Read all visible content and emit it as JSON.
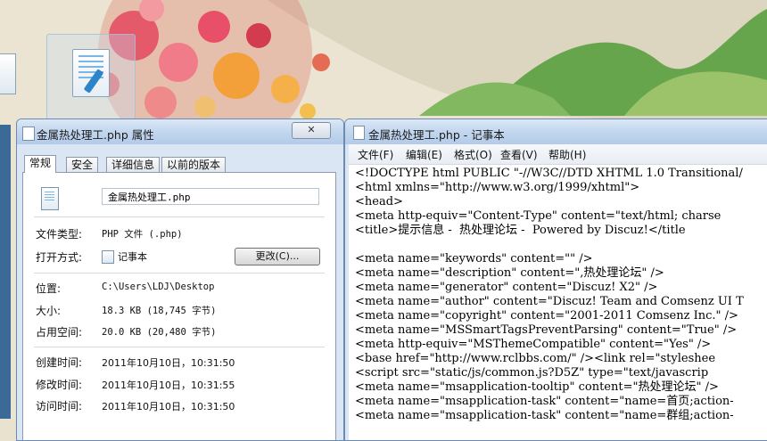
{
  "properties_dialog": {
    "title": "金属热处理工.php 属性",
    "close_label": "✕",
    "tabs": [
      {
        "label": "常规",
        "active": true
      },
      {
        "label": "安全",
        "active": false
      },
      {
        "label": "详细信息",
        "active": false
      },
      {
        "label": "以前的版本",
        "active": false
      }
    ],
    "file_name": "金属热处理工.php",
    "rows": {
      "file_type": {
        "label": "文件类型:",
        "value": "PHP 文件 (.php)"
      },
      "open_with": {
        "label": "打开方式:",
        "value": "记事本",
        "button": "更改(C)..."
      },
      "location": {
        "label": "位置:",
        "value": "C:\\Users\\LDJ\\Desktop"
      },
      "size": {
        "label": "大小:",
        "value": "18.3 KB (18,745 字节)"
      },
      "size_on_disk": {
        "label": "占用空间:",
        "value": "20.0 KB (20,480 字节)"
      },
      "created": {
        "label": "创建时间:",
        "value": "2011年10月10日，10:31:50"
      },
      "modified": {
        "label": "修改时间:",
        "value": "2011年10月10日，10:31:55"
      },
      "accessed": {
        "label": "访问时间:",
        "value": "2011年10月10日，10:31:50"
      }
    }
  },
  "notepad": {
    "title": "金属热处理工.php - 记事本",
    "menu": [
      "文件(F)",
      "编辑(E)",
      "格式(O)",
      "查看(V)",
      "帮助(H)"
    ],
    "lines": [
      "<!DOCTYPE html PUBLIC \"-//W3C//DTD XHTML 1.0 Transitional/",
      "<html xmlns=\"http://www.w3.org/1999/xhtml\">",
      "<head>",
      "<meta http-equiv=\"Content-Type\" content=\"text/html; charse",
      "<title>提示信息 -  热处理论坛 -  Powered by Discuz!</title",
      "",
      "<meta name=\"keywords\" content=\"\" />",
      "<meta name=\"description\" content=\",热处理论坛\" />",
      "<meta name=\"generator\" content=\"Discuz! X2\" />",
      "<meta name=\"author\" content=\"Discuz! Team and Comsenz UI T",
      "<meta name=\"copyright\" content=\"2001-2011 Comsenz Inc.\" />",
      "<meta name=\"MSSmartTagsPreventParsing\" content=\"True\" />",
      "<meta http-equiv=\"MSThemeCompatible\" content=\"Yes\" />",
      "<base href=\"http://www.rclbbs.com/\" /><link rel=\"styleshee",
      "<script src=\"static/js/common.js?D5Z\" type=\"text/javascrip",
      "<meta name=\"msapplication-tooltip\" content=\"热处理论坛\" />",
      "<meta name=\"msapplication-task\" content=\"name=首页;action-",
      "<meta name=\"msapplication-task\" content=\"name=群组;action-"
    ]
  }
}
